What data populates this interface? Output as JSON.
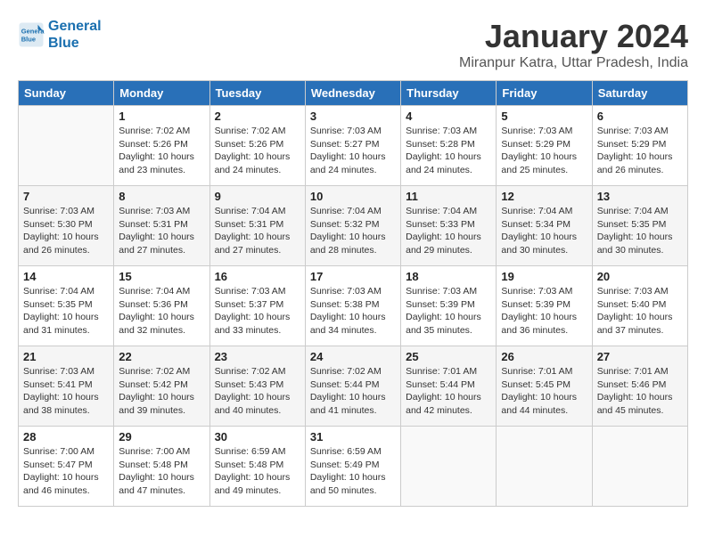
{
  "logo": {
    "line1": "General",
    "line2": "Blue"
  },
  "title": "January 2024",
  "subtitle": "Miranpur Katra, Uttar Pradesh, India",
  "weekdays": [
    "Sunday",
    "Monday",
    "Tuesday",
    "Wednesday",
    "Thursday",
    "Friday",
    "Saturday"
  ],
  "weeks": [
    [
      {
        "day": "",
        "content": ""
      },
      {
        "day": "1",
        "content": "Sunrise: 7:02 AM\nSunset: 5:26 PM\nDaylight: 10 hours\nand 23 minutes."
      },
      {
        "day": "2",
        "content": "Sunrise: 7:02 AM\nSunset: 5:26 PM\nDaylight: 10 hours\nand 24 minutes."
      },
      {
        "day": "3",
        "content": "Sunrise: 7:03 AM\nSunset: 5:27 PM\nDaylight: 10 hours\nand 24 minutes."
      },
      {
        "day": "4",
        "content": "Sunrise: 7:03 AM\nSunset: 5:28 PM\nDaylight: 10 hours\nand 24 minutes."
      },
      {
        "day": "5",
        "content": "Sunrise: 7:03 AM\nSunset: 5:29 PM\nDaylight: 10 hours\nand 25 minutes."
      },
      {
        "day": "6",
        "content": "Sunrise: 7:03 AM\nSunset: 5:29 PM\nDaylight: 10 hours\nand 26 minutes."
      }
    ],
    [
      {
        "day": "7",
        "content": "Sunrise: 7:03 AM\nSunset: 5:30 PM\nDaylight: 10 hours\nand 26 minutes."
      },
      {
        "day": "8",
        "content": "Sunrise: 7:03 AM\nSunset: 5:31 PM\nDaylight: 10 hours\nand 27 minutes."
      },
      {
        "day": "9",
        "content": "Sunrise: 7:04 AM\nSunset: 5:31 PM\nDaylight: 10 hours\nand 27 minutes."
      },
      {
        "day": "10",
        "content": "Sunrise: 7:04 AM\nSunset: 5:32 PM\nDaylight: 10 hours\nand 28 minutes."
      },
      {
        "day": "11",
        "content": "Sunrise: 7:04 AM\nSunset: 5:33 PM\nDaylight: 10 hours\nand 29 minutes."
      },
      {
        "day": "12",
        "content": "Sunrise: 7:04 AM\nSunset: 5:34 PM\nDaylight: 10 hours\nand 30 minutes."
      },
      {
        "day": "13",
        "content": "Sunrise: 7:04 AM\nSunset: 5:35 PM\nDaylight: 10 hours\nand 30 minutes."
      }
    ],
    [
      {
        "day": "14",
        "content": "Sunrise: 7:04 AM\nSunset: 5:35 PM\nDaylight: 10 hours\nand 31 minutes."
      },
      {
        "day": "15",
        "content": "Sunrise: 7:04 AM\nSunset: 5:36 PM\nDaylight: 10 hours\nand 32 minutes."
      },
      {
        "day": "16",
        "content": "Sunrise: 7:03 AM\nSunset: 5:37 PM\nDaylight: 10 hours\nand 33 minutes."
      },
      {
        "day": "17",
        "content": "Sunrise: 7:03 AM\nSunset: 5:38 PM\nDaylight: 10 hours\nand 34 minutes."
      },
      {
        "day": "18",
        "content": "Sunrise: 7:03 AM\nSunset: 5:39 PM\nDaylight: 10 hours\nand 35 minutes."
      },
      {
        "day": "19",
        "content": "Sunrise: 7:03 AM\nSunset: 5:39 PM\nDaylight: 10 hours\nand 36 minutes."
      },
      {
        "day": "20",
        "content": "Sunrise: 7:03 AM\nSunset: 5:40 PM\nDaylight: 10 hours\nand 37 minutes."
      }
    ],
    [
      {
        "day": "21",
        "content": "Sunrise: 7:03 AM\nSunset: 5:41 PM\nDaylight: 10 hours\nand 38 minutes."
      },
      {
        "day": "22",
        "content": "Sunrise: 7:02 AM\nSunset: 5:42 PM\nDaylight: 10 hours\nand 39 minutes."
      },
      {
        "day": "23",
        "content": "Sunrise: 7:02 AM\nSunset: 5:43 PM\nDaylight: 10 hours\nand 40 minutes."
      },
      {
        "day": "24",
        "content": "Sunrise: 7:02 AM\nSunset: 5:44 PM\nDaylight: 10 hours\nand 41 minutes."
      },
      {
        "day": "25",
        "content": "Sunrise: 7:01 AM\nSunset: 5:44 PM\nDaylight: 10 hours\nand 42 minutes."
      },
      {
        "day": "26",
        "content": "Sunrise: 7:01 AM\nSunset: 5:45 PM\nDaylight: 10 hours\nand 44 minutes."
      },
      {
        "day": "27",
        "content": "Sunrise: 7:01 AM\nSunset: 5:46 PM\nDaylight: 10 hours\nand 45 minutes."
      }
    ],
    [
      {
        "day": "28",
        "content": "Sunrise: 7:00 AM\nSunset: 5:47 PM\nDaylight: 10 hours\nand 46 minutes."
      },
      {
        "day": "29",
        "content": "Sunrise: 7:00 AM\nSunset: 5:48 PM\nDaylight: 10 hours\nand 47 minutes."
      },
      {
        "day": "30",
        "content": "Sunrise: 6:59 AM\nSunset: 5:48 PM\nDaylight: 10 hours\nand 49 minutes."
      },
      {
        "day": "31",
        "content": "Sunrise: 6:59 AM\nSunset: 5:49 PM\nDaylight: 10 hours\nand 50 minutes."
      },
      {
        "day": "",
        "content": ""
      },
      {
        "day": "",
        "content": ""
      },
      {
        "day": "",
        "content": ""
      }
    ]
  ]
}
